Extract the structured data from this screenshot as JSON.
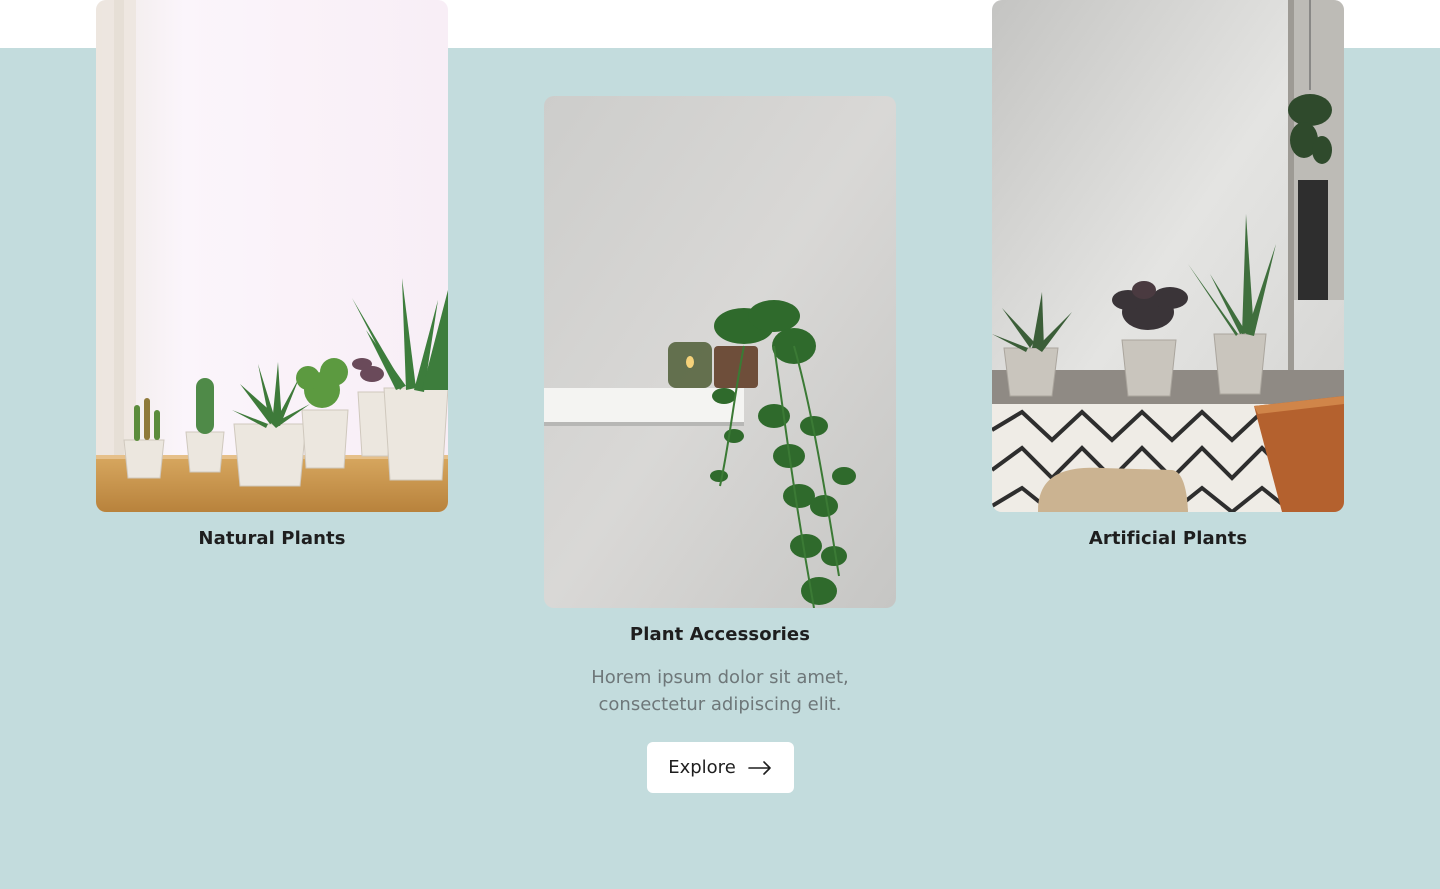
{
  "categories": [
    {
      "title": "Natural Plants",
      "image": "natural-plants-photo"
    },
    {
      "title": "Plant Accessories",
      "image": "plant-accessories-photo",
      "description": "Horem ipsum dolor sit amet, consectetur adipiscing elit.",
      "cta_label": "Explore",
      "cta_icon": "arrow-right-icon"
    },
    {
      "title": "Artificial Plants",
      "image": "artificial-plants-photo"
    }
  ],
  "colors": {
    "section_background": "#c3dcdd",
    "top_band": "#ffffff",
    "title_text": "#1e1e1e",
    "body_text": "#6e7779",
    "button_background": "#ffffff"
  }
}
